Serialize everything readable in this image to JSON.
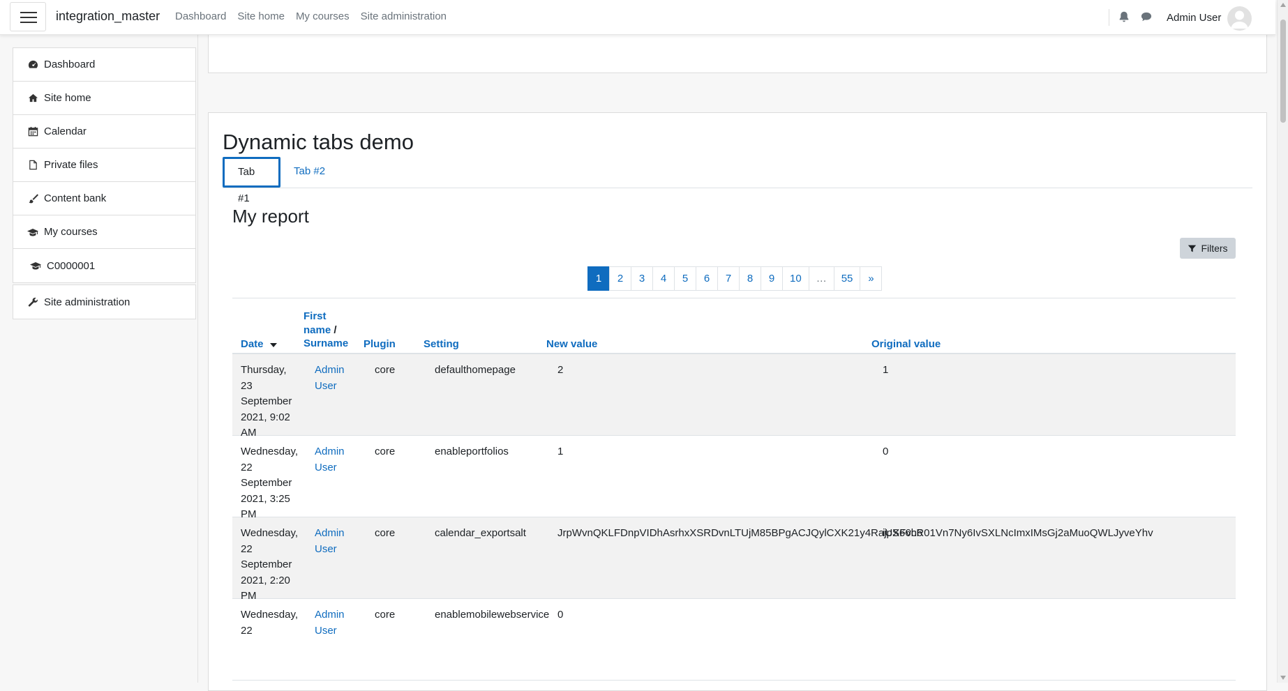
{
  "navbar": {
    "brand": "integration_master",
    "links": [
      "Dashboard",
      "Site home",
      "My courses",
      "Site administration"
    ],
    "user_name": "Admin User"
  },
  "drawer": {
    "items": [
      {
        "label": "Dashboard",
        "icon": "dashboard-icon"
      },
      {
        "label": "Site home",
        "icon": "home-icon"
      },
      {
        "label": "Calendar",
        "icon": "calendar-icon"
      },
      {
        "label": "Private files",
        "icon": "file-icon"
      },
      {
        "label": "Content bank",
        "icon": "paintbrush-icon"
      },
      {
        "label": "My courses",
        "icon": "graduation-cap-icon"
      },
      {
        "label": "C0000001",
        "icon": "graduation-cap-icon"
      }
    ],
    "admin_item": {
      "label": "Site administration",
      "icon": "wrench-icon"
    }
  },
  "main": {
    "title": "Dynamic tabs demo",
    "tabs": [
      "Tab #1",
      "Tab #2"
    ],
    "report_title": "My report",
    "filters_label": "Filters",
    "pagination": [
      "1",
      "2",
      "3",
      "4",
      "5",
      "6",
      "7",
      "8",
      "9",
      "10",
      "…",
      "55",
      "»"
    ],
    "current_page": "1",
    "table": {
      "headers": {
        "date": "Date",
        "firstname": "First name",
        "sep": "/",
        "surname": "Surname",
        "plugin": "Plugin",
        "setting": "Setting",
        "new_value": "New value",
        "original_value": "Original value"
      },
      "rows": [
        {
          "date": "Thursday, 23 September 2021, 9:02 AM",
          "user": "Admin User",
          "plugin": "core",
          "setting": "defaulthomepage",
          "new_value": "2",
          "original_value": "1"
        },
        {
          "date": "Wednesday, 22 September 2021, 3:25 PM",
          "user": "Admin User",
          "plugin": "core",
          "setting": "enableportfolios",
          "new_value": "1",
          "original_value": "0"
        },
        {
          "date": "Wednesday, 22 September 2021, 2:20 PM",
          "user": "Admin User",
          "plugin": "core",
          "setting": "calendar_exportsalt",
          "new_value": "JrpWvnQKLFDnpVIDhAsrhxXSRDvnLTUjM85BPgACJQylCXK21y4RajpS66h6",
          "original_value": "iUXFvcR01Vn7Ny6IvSXLNcImxIMsGj2aMuoQWLJyveYhv"
        },
        {
          "date": "Wednesday, 22",
          "user": "Admin User",
          "plugin": "core",
          "setting": "enablemobilewebservice",
          "new_value": "0",
          "original_value": ""
        }
      ]
    }
  },
  "colors": {
    "accent": "#0f6cbf",
    "text": "#1d2125",
    "muted": "#6a737b",
    "row_alt": "#f2f2f2"
  }
}
